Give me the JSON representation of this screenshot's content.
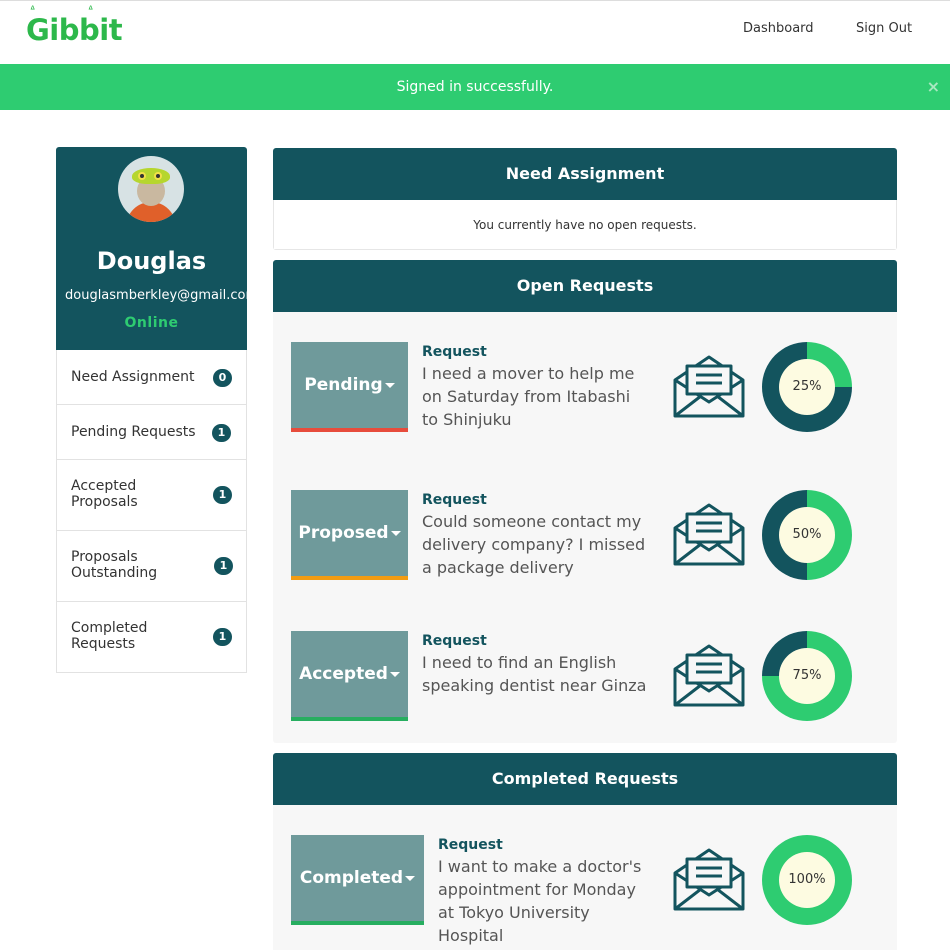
{
  "brand": {
    "logo_text": "Gibbit",
    "crown": "ᐞ ᐞ"
  },
  "nav": {
    "dashboard": "Dashboard",
    "sign_out": "Sign Out"
  },
  "flash": {
    "message": "Signed in successfully.",
    "close": "×"
  },
  "profile": {
    "name": "Douglas",
    "email": "douglasmberkley@gmail.com",
    "status": "Online"
  },
  "sidebar": {
    "items": [
      {
        "label": "Need Assignment",
        "count": "0"
      },
      {
        "label": "Pending Requests",
        "count": "1"
      },
      {
        "label": "Accepted\nProposals",
        "count": "1"
      },
      {
        "label": "Proposals\nOutstanding",
        "count": "1"
      },
      {
        "label": "Completed\nRequests",
        "count": "1"
      }
    ]
  },
  "panels": {
    "need_assignment": {
      "title": "Need Assignment",
      "empty_text": "You currently have no open requests."
    },
    "open_requests": {
      "title": "Open Requests"
    },
    "completed_requests": {
      "title": "Completed Requests"
    }
  },
  "requests": [
    {
      "status": "Pending",
      "title": "Request",
      "text": "I need a mover to help me on Saturday from Itabashi to Shinjuku",
      "progress_label": "25%",
      "progress": 0.25,
      "status_color": "#e74c3c"
    },
    {
      "status": "Proposed",
      "title": "Request",
      "text": "Could someone contact my delivery company? I missed a package delivery",
      "progress_label": "50%",
      "progress": 0.5,
      "status_color": "#f39c12"
    },
    {
      "status": "Accepted",
      "title": "Request",
      "text": "I need to find an English speaking dentist near Ginza",
      "progress_label": "75%",
      "progress": 0.75,
      "status_color": "#27ae60"
    },
    {
      "status": "Completed",
      "title": "Request",
      "text": "I want to make a doctor's appointment for Monday at Tokyo University Hospital",
      "progress_label": "100%",
      "progress": 1.0,
      "status_color": "#27ae60"
    }
  ],
  "colors": {
    "primary": "#13545e",
    "success": "#2ecc71",
    "ring_fill": "#2ecc71",
    "ring_track": "#13545e"
  },
  "icons": {
    "mail": "envelope-open-icon",
    "close": "close-icon",
    "caret": "caret-down-icon"
  }
}
